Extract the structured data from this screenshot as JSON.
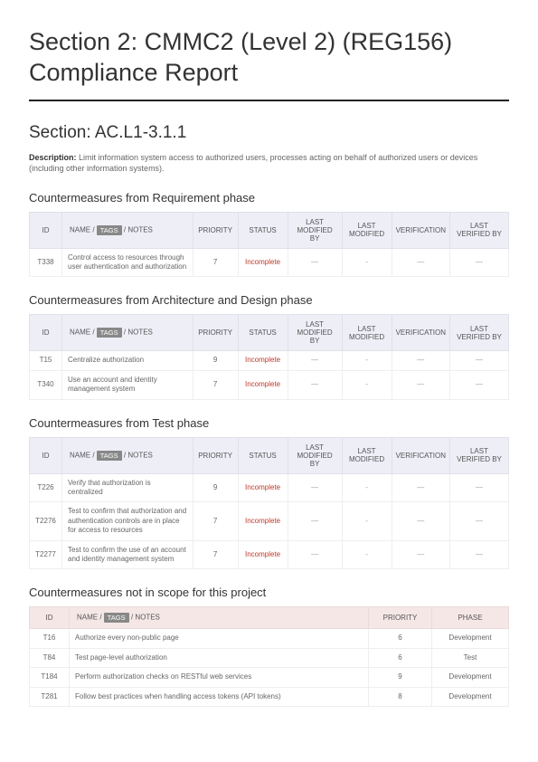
{
  "title": "Section 2: CMMC2 (Level 2) (REG156) Compliance Report",
  "section_title": "Section: AC.L1-3.1.1",
  "description_label": "Description:",
  "description_text": "Limit information system access to authorized users, processes acting on behalf of authorized users or devices (including other information systems).",
  "headers": {
    "id": "ID",
    "name_prefix": "NAME / ",
    "tags": "TAGS",
    "name_suffix": " / NOTES",
    "priority": "PRIORITY",
    "status": "STATUS",
    "last_modified_by": "LAST MODIFIED BY",
    "last_modified": "LAST MODIFIED",
    "verification": "VERIFICATION",
    "last_verified_by": "LAST VERIFIED BY",
    "phase": "PHASE"
  },
  "dash": "—",
  "dash2": "-",
  "phases": {
    "requirement": {
      "heading": "Countermeasures from Requirement phase",
      "rows": [
        {
          "id": "T338",
          "name": "Control access to resources through user authentication and authorization",
          "priority": "7",
          "status": "Incomplete"
        }
      ]
    },
    "architecture": {
      "heading": "Countermeasures from Architecture and Design phase",
      "rows": [
        {
          "id": "T15",
          "name": "Centralize authorization",
          "priority": "9",
          "status": "Incomplete"
        },
        {
          "id": "T340",
          "name": "Use an account and identity management system",
          "priority": "7",
          "status": "Incomplete"
        }
      ]
    },
    "test": {
      "heading": "Countermeasures from Test phase",
      "rows": [
        {
          "id": "T226",
          "name": "Verify that authorization is centralized",
          "priority": "9",
          "status": "Incomplete"
        },
        {
          "id": "T2276",
          "name": "Test to confirm that authorization and authentication controls are in place for access to resources",
          "priority": "7",
          "status": "Incomplete"
        },
        {
          "id": "T2277",
          "name": "Test to confirm the use of an account and identity management system",
          "priority": "7",
          "status": "Incomplete"
        }
      ]
    }
  },
  "notinscope": {
    "heading": "Countermeasures not in scope for this project",
    "rows": [
      {
        "id": "T16",
        "name": "Authorize every non-public page",
        "priority": "6",
        "phase": "Development"
      },
      {
        "id": "T84",
        "name": "Test page-level authorization",
        "priority": "6",
        "phase": "Test"
      },
      {
        "id": "T184",
        "name": "Perform authorization checks on RESTful web services",
        "priority": "9",
        "phase": "Development"
      },
      {
        "id": "T281",
        "name": "Follow best practices when handling access tokens (API tokens)",
        "priority": "8",
        "phase": "Development"
      }
    ]
  }
}
